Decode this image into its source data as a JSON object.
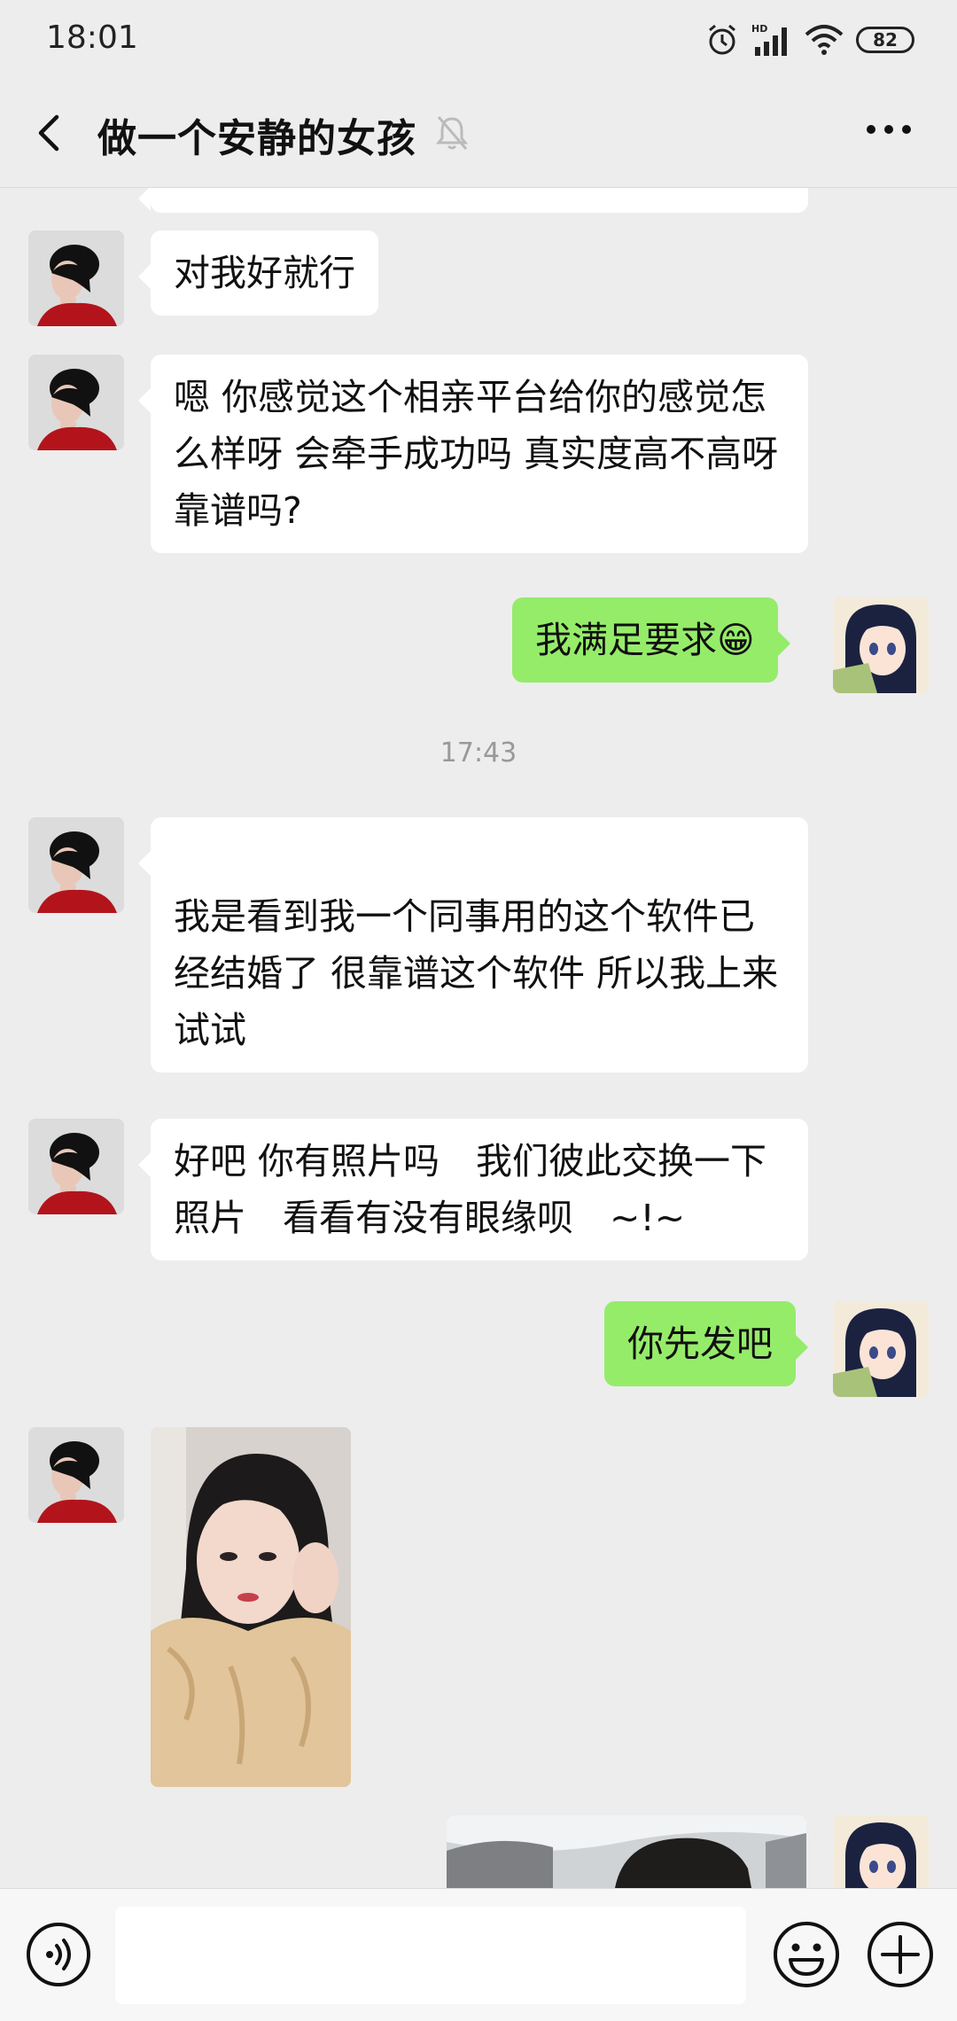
{
  "status_bar": {
    "time": "18:01",
    "battery": "82",
    "icons": [
      "alarm-icon",
      "hd-signal-icon",
      "wifi-icon",
      "battery-icon"
    ]
  },
  "header": {
    "title": "做一个安静的女孩",
    "icons": [
      "back-icon",
      "mute-bell-icon",
      "more-icon"
    ]
  },
  "messages": [
    {
      "sender": "her",
      "text": "对我好就行"
    },
    {
      "sender": "her",
      "text": "嗯 你感觉这个相亲平台给你的感觉怎么样呀 会牵手成功吗 真实度高不高呀 靠谱吗?"
    },
    {
      "sender": "me",
      "text": "我满足要求😁"
    },
    {
      "type": "time",
      "text": "17:43"
    },
    {
      "sender": "her",
      "text": "我是看到我一个同事用的这个软件已经结婚了 很靠谱这个软件 所以我上来试试"
    },
    {
      "sender": "her",
      "text": "好吧 你有照片吗　我们彼此交换一下照片　看看有没有眼缘呗　~!~"
    },
    {
      "sender": "me",
      "text": "你先发吧"
    },
    {
      "sender": "her",
      "type": "image"
    },
    {
      "sender": "me",
      "type": "image"
    }
  ],
  "input_bar": {
    "text": "",
    "icons": [
      "voice-icon",
      "emoji-icon",
      "plus-icon"
    ]
  },
  "colors": {
    "background": "#ededed",
    "incoming_bubble": "#ffffff",
    "outgoing_bubble": "#95ec69",
    "timestamp": "#999999"
  }
}
